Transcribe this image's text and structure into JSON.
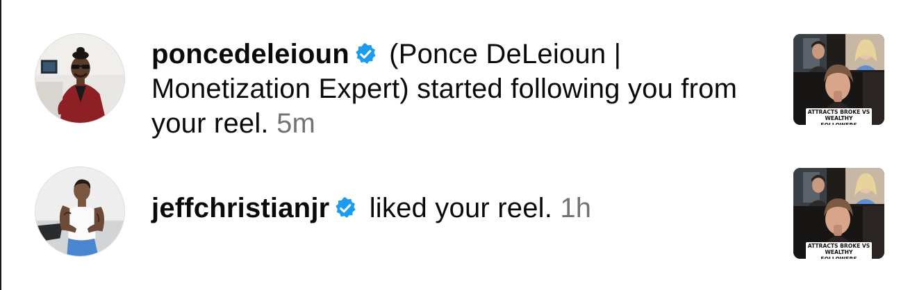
{
  "notifications": [
    {
      "username": "poncedeleioun",
      "verified": true,
      "message": " (Ponce DeLeioun | Monetization Expert) started following you from your reel. ",
      "time": "5m",
      "thumbnail": {
        "caption_line1": "ATTRACTS BROKE VS",
        "caption_line2": "WEALTHY FOLLOWERS"
      }
    },
    {
      "username": "jeffchristianjr",
      "verified": true,
      "message": " liked your reel. ",
      "time": "1h",
      "thumbnail": {
        "caption_line1": "ATTRACTS BROKE VS",
        "caption_line2": "WEALTHY FOLLOWERS"
      }
    }
  ],
  "colors": {
    "verified_blue": "#1d9bf0",
    "timestamp_gray": "#737373",
    "text": "#0a0a0a"
  },
  "icons": [
    "verified-badge-icon"
  ]
}
